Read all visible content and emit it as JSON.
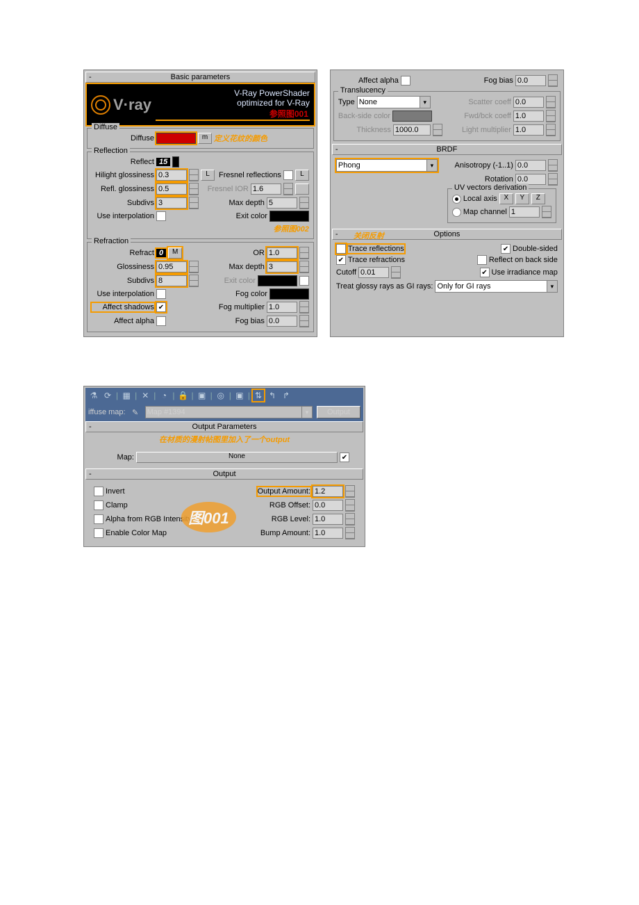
{
  "basic": {
    "title": "Basic parameters",
    "banner": {
      "heading": "V·ray",
      "line1": "V-Ray PowerShader",
      "line2": "optimized for V-Ray",
      "ref": "参照图001"
    },
    "diffuse": {
      "title": "Diffuse",
      "label": "Diffuse",
      "map_btn": "m",
      "note": "定义花纹的颜色"
    },
    "reflection": {
      "title": "Reflection",
      "reflect_label": "Reflect",
      "reflect_call": "15",
      "hilight_label": "Hilight glossiness",
      "hilight_val": "0.3",
      "l_btn": "L",
      "fresnel_label": "Fresnel reflections",
      "fresnel_l_btn": "L",
      "reflgloss_label": "Refl. glossiness",
      "reflgloss_val": "0.5",
      "fresnelior_label": "Fresnel IOR",
      "fresnelior_val": "1.6",
      "subdivs_label": "Subdivs",
      "subdivs_val": "3",
      "maxdepth_label": "Max depth",
      "maxdepth_val": "5",
      "interp_label": "Use interpolation",
      "exitcolor_label": "Exit color",
      "ref": "参照图002"
    },
    "refraction": {
      "title": "Refraction",
      "refract_label": "Refract",
      "refract_call": "0",
      "m_btn": "M",
      "ior_label": "OR",
      "ior_val": "1.0",
      "gloss_label": "Glossiness",
      "gloss_val": "0.95",
      "maxdepth_label": "Max depth",
      "maxdepth_val": "3",
      "subdivs_label": "Subdivs",
      "subdivs_val": "8",
      "exitcolor_label": "Exit color",
      "interp_label": "Use interpolation",
      "fogcolor_label": "Fog color",
      "affectshadows_label": "Affect shadows",
      "fogmult_label": "Fog multiplier",
      "fogmult_val": "1.0",
      "affectalpha_label": "Affect alpha",
      "fogbias_label": "Fog bias",
      "fogbias_val": "0.0"
    }
  },
  "rightTop": {
    "affectalpha_label": "Affect alpha",
    "fogbias_label": "Fog bias",
    "fogbias_val": "0.0"
  },
  "trans": {
    "title": "Translucency",
    "type_label": "Type",
    "type_val": "None",
    "scatter_label": "Scatter coeff",
    "scatter_val": "0.0",
    "back_label": "Back-side color",
    "fwd_label": "Fwd/bck coeff",
    "fwd_val": "1.0",
    "thick_label": "Thickness",
    "thick_val": "1000.0",
    "light_label": "Light multiplier",
    "light_val": "1.0"
  },
  "brdf": {
    "title": "BRDF",
    "type_val": "Phong",
    "aniso_label": "Anisotropy (-1..1)",
    "aniso_val": "0.0",
    "rot_label": "Rotation",
    "rot_val": "0.0",
    "uv_title": "UV vectors derivation",
    "local_label": "Local axis",
    "x": "X",
    "y": "Y",
    "z": "Z",
    "mapch_label": "Map channel",
    "mapch_val": "1"
  },
  "options": {
    "title": "Options",
    "note": "关闭反射",
    "trace_refl": "Trace reflections",
    "double_sided": "Double-sided",
    "trace_refr": "Trace refractions",
    "refl_back": "Reflect on back side",
    "cutoff_label": "Cutoff",
    "cutoff_val": "0.01",
    "use_irr": "Use irradiance map",
    "treat_label": "Treat glossy rays as GI rays:",
    "treat_val": "Only for GI rays"
  },
  "lower": {
    "diffmap_label": "iffuse map:",
    "map_val": "Map #1394",
    "output_btn": "Output",
    "outparam_title": "Output Parameters",
    "outparam_note": "在材质的漫射帖图里加入了一个output",
    "map_label": "Map:",
    "map_none": "None",
    "output_title": "Output",
    "invert": "Invert",
    "clamp": "Clamp",
    "alpha": "Alpha from RGB Intensity",
    "enable": "Enable Color Map",
    "outamt_label": "Output Amount:",
    "outamt_val": "1.2",
    "rgboff_label": "RGB Offset:",
    "rgboff_val": "0.0",
    "rgblvl_label": "RGB Level:",
    "rgblvl_val": "1.0",
    "bump_label": "Bump Amount:",
    "bump_val": "1.0",
    "badge": "图001"
  }
}
